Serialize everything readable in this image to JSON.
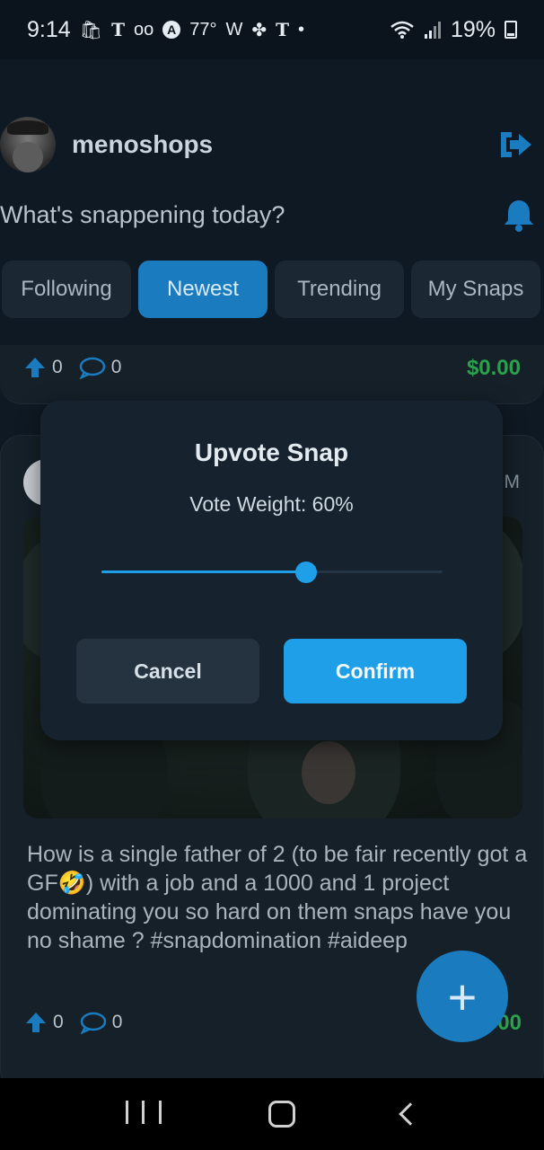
{
  "status_bar": {
    "time": "9:14",
    "icons": [
      "shopping-bag-icon",
      "t-mobile-icon",
      "voicemail-icon",
      "arc-icon",
      "weather-temp",
      "w-icon",
      "pinwheel-icon",
      "t-mobile-icon",
      "dot-icon"
    ],
    "temperature": "77°",
    "battery": "19%"
  },
  "header": {
    "username": "menoshops",
    "prompt": "What's snappening today?",
    "accent_color": "#1b7bbf"
  },
  "tabs": [
    {
      "label": "Following",
      "active": false
    },
    {
      "label": "Newest",
      "active": true
    },
    {
      "label": "Trending",
      "active": false
    },
    {
      "label": "My Snaps",
      "active": false
    }
  ],
  "top_card": {
    "upvotes": "0",
    "comments": "0",
    "payout": "$0.00"
  },
  "post": {
    "time_suffix": "M",
    "text": "How is a single father of 2 (to be fair recently got a GF🤣) with a job and a 1000 and 1 project dominating you so hard on them snaps have you no shame ? #snapdomination #aideep",
    "upvotes": "0",
    "comments": "0",
    "payout": "00"
  },
  "modal": {
    "title": "Upvote Snap",
    "vote_weight_text": "Vote Weight: 60%",
    "vote_weight": 0.6,
    "cancel_label": "Cancel",
    "confirm_label": "Confirm"
  },
  "fab_label": "+",
  "colors": {
    "payout_green": "#2ba14c",
    "confirm_blue": "#1e9fe8"
  }
}
